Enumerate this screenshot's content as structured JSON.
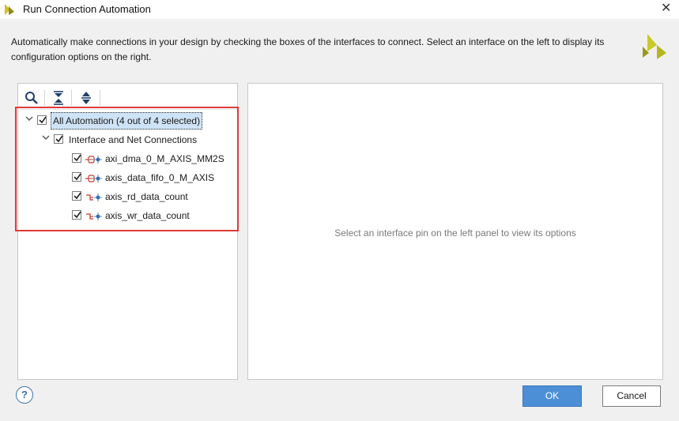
{
  "window": {
    "title": "Run Connection Automation",
    "close_glyph": "✕"
  },
  "description": "Automatically make connections in your design by checking the boxes of the interfaces to connect. Select an interface on the left to display its configuration options on the right.",
  "toolbar": {
    "icons": [
      "search-icon",
      "collapse-all-icon",
      "expand-all-icon"
    ]
  },
  "tree": {
    "root": {
      "label": "All Automation (4 out of 4 selected)",
      "checked": true,
      "expanded": true,
      "selected": true
    },
    "group": {
      "label": "Interface and Net Connections",
      "checked": true,
      "expanded": true
    },
    "items": [
      {
        "label": "axi_dma_0_M_AXIS_MM2S",
        "checked": true,
        "icon": "bus-interface-icon"
      },
      {
        "label": "axis_data_fifo_0_M_AXIS",
        "checked": true,
        "icon": "bus-interface-icon"
      },
      {
        "label": "axis_rd_data_count",
        "checked": true,
        "icon": "net-pin-icon"
      },
      {
        "label": "axis_wr_data_count",
        "checked": true,
        "icon": "net-pin-icon"
      }
    ]
  },
  "right_panel": {
    "message": "Select an interface pin on the left panel to view its options"
  },
  "buttons": {
    "help": "?",
    "ok": "OK",
    "cancel": "Cancel"
  },
  "colors": {
    "accent": "#4d8fd6",
    "highlight": "#e03a3a",
    "selection": "#cfe3f7",
    "brand": "#b8b820"
  }
}
